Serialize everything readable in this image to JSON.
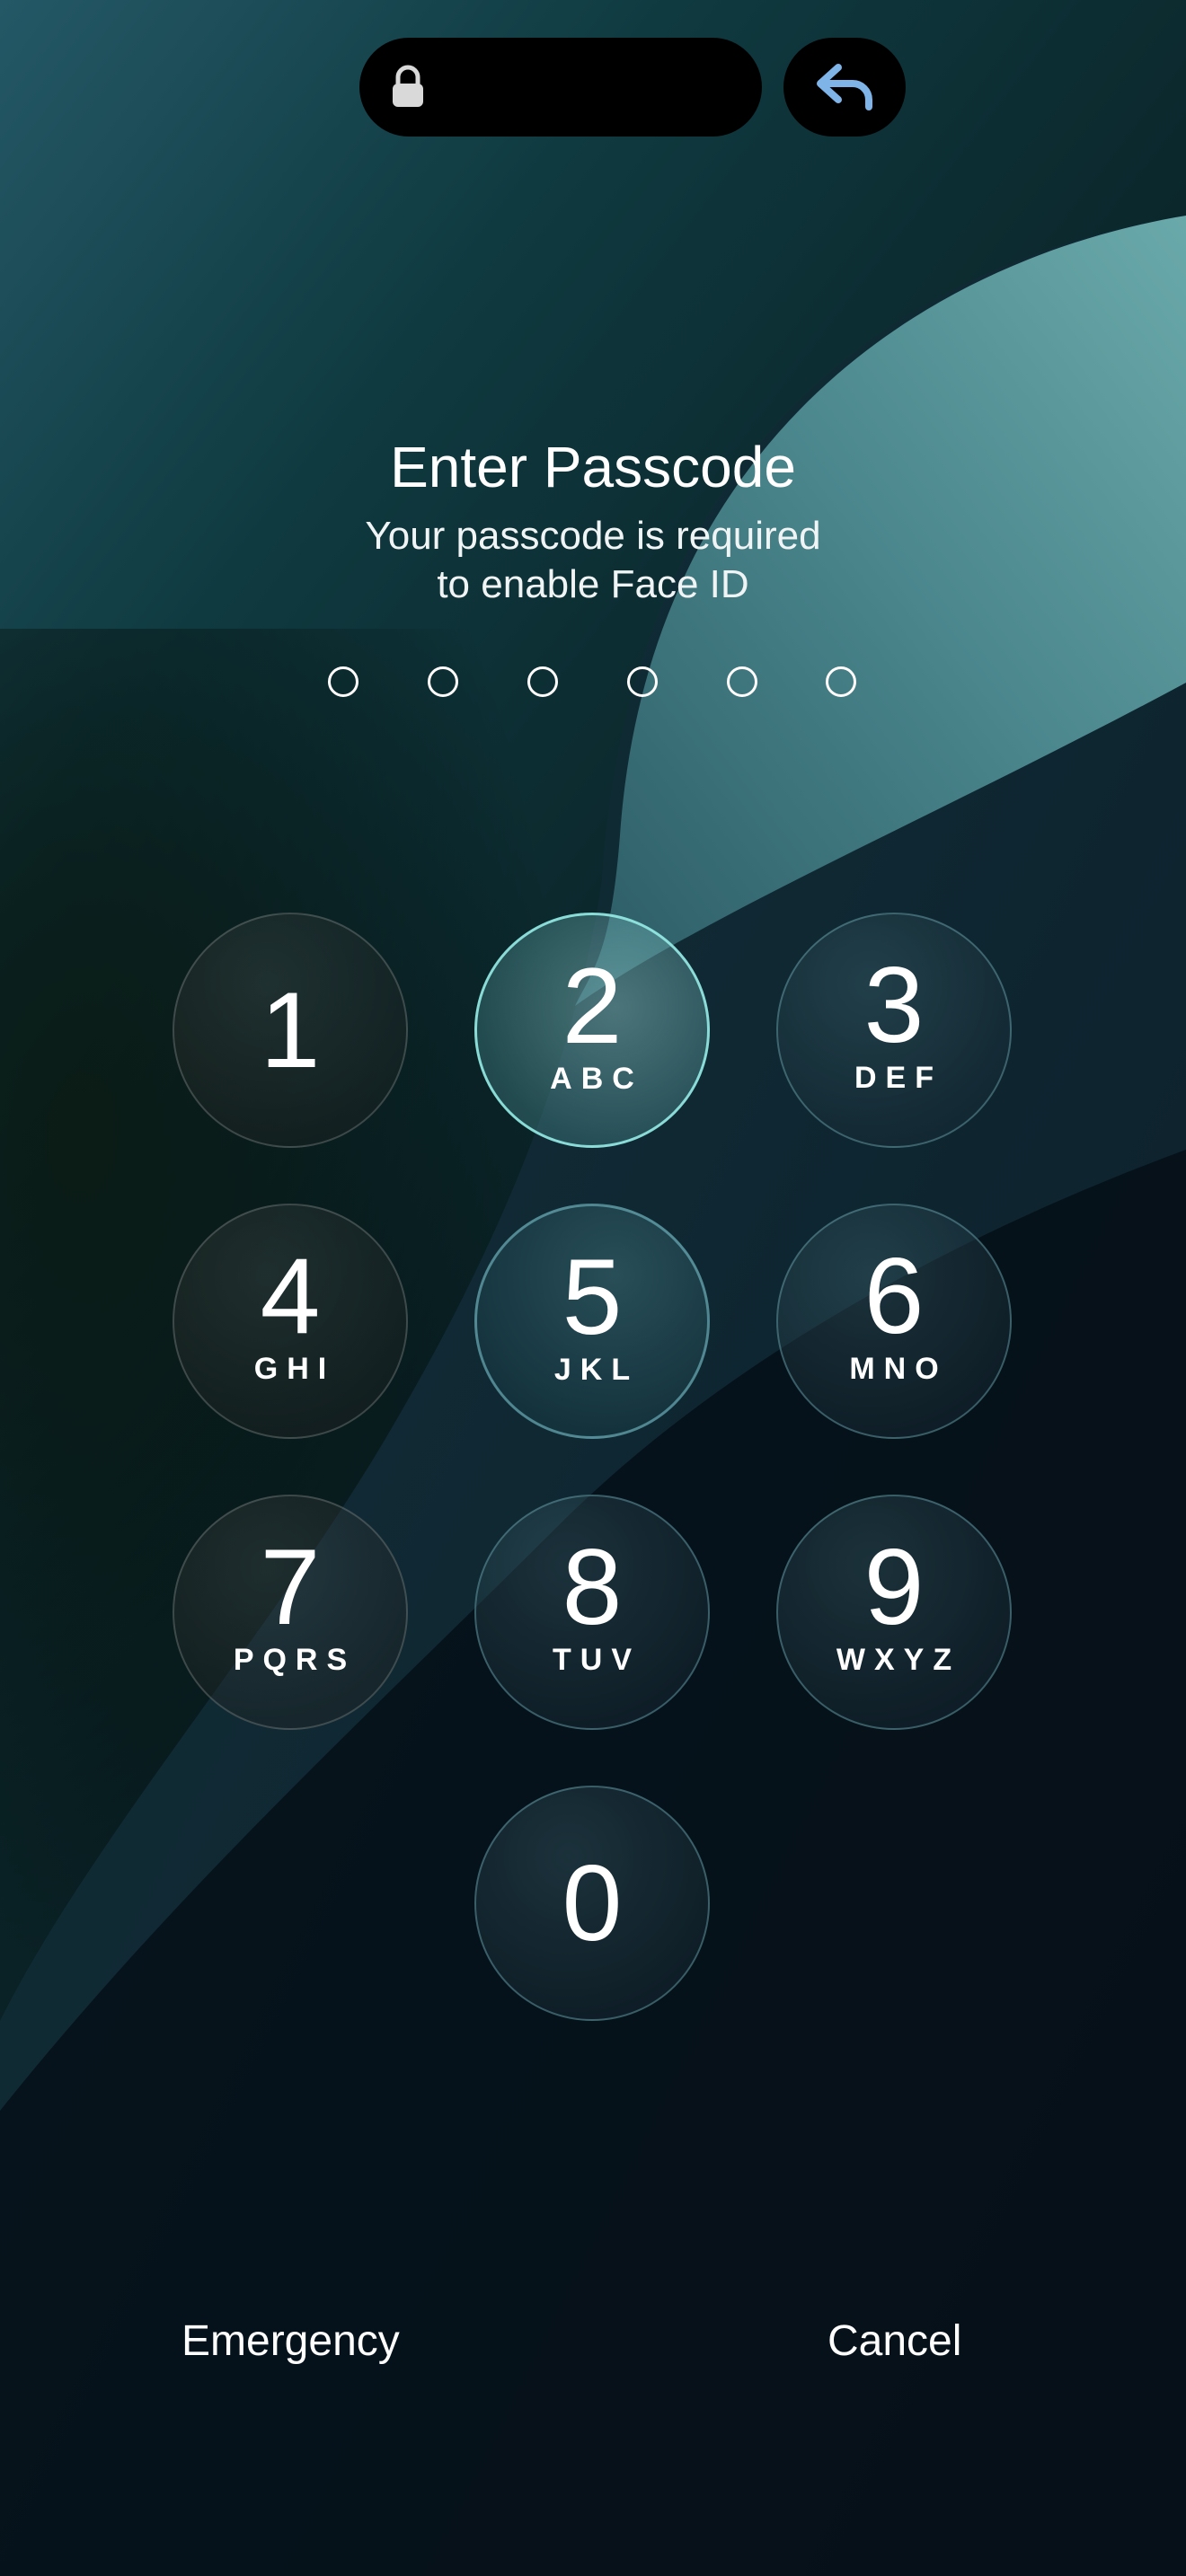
{
  "status": {
    "lock_icon": "lock-icon",
    "back_icon": "reply-arrow-icon",
    "accent": "#7fb4e8"
  },
  "prompt": {
    "title": "Enter Passcode",
    "subtitle_line1": "Your passcode is required",
    "subtitle_line2": "to enable Face ID"
  },
  "passcode": {
    "length": 6,
    "entered": 0
  },
  "keypad": {
    "keys": [
      {
        "digit": "1",
        "letters": ""
      },
      {
        "digit": "2",
        "letters": "ABC"
      },
      {
        "digit": "3",
        "letters": "DEF"
      },
      {
        "digit": "4",
        "letters": "GHI"
      },
      {
        "digit": "5",
        "letters": "JKL"
      },
      {
        "digit": "6",
        "letters": "MNO"
      },
      {
        "digit": "7",
        "letters": "PQRS"
      },
      {
        "digit": "8",
        "letters": "TUV"
      },
      {
        "digit": "9",
        "letters": "WXYZ"
      },
      {
        "digit": "0",
        "letters": ""
      }
    ]
  },
  "actions": {
    "emergency": "Emergency",
    "cancel": "Cancel"
  }
}
